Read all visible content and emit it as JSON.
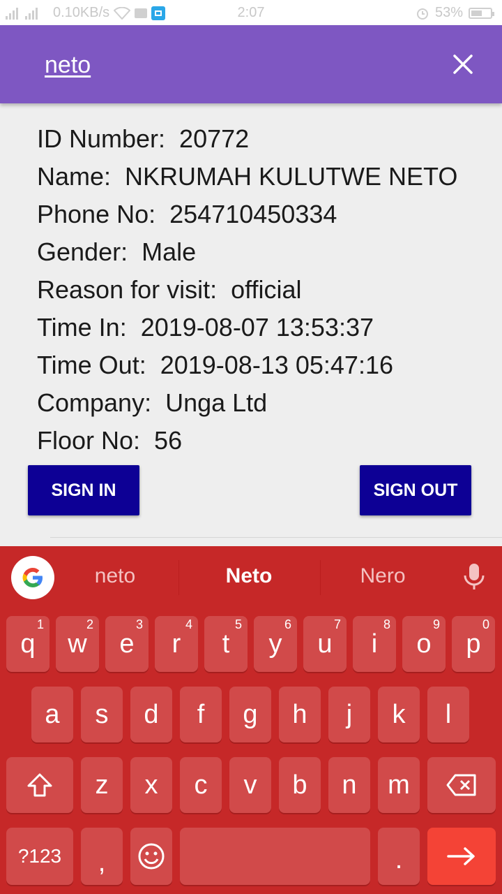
{
  "status_bar": {
    "network_speed": "0.10KB/s",
    "time": "2:07",
    "battery": "53%",
    "battery_level": 0.53
  },
  "app_bar": {
    "search_query": "neto",
    "close_icon": "close-icon"
  },
  "visitor": {
    "fields": [
      {
        "label": "ID Number:",
        "value": "20772"
      },
      {
        "label": "Name:",
        "value": "NKRUMAH KULUTWE NETO"
      },
      {
        "label": "Phone No:",
        "value": "254710450334"
      },
      {
        "label": "Gender:",
        "value": "Male"
      },
      {
        "label": "Reason for visit:",
        "value": "official"
      },
      {
        "label": "Time In:",
        "value": "2019-08-07 13:53:37"
      },
      {
        "label": "Time Out:",
        "value": "2019-08-13 05:47:16"
      },
      {
        "label": "Company:",
        "value": "Unga Ltd"
      },
      {
        "label": "Floor No:",
        "value": "56"
      }
    ]
  },
  "actions": {
    "sign_in": "SIGN IN",
    "sign_out": "SIGN OUT"
  },
  "keyboard": {
    "suggestions": [
      "neto",
      "Neto",
      "Nero"
    ],
    "row1": [
      [
        "q",
        "1"
      ],
      [
        "w",
        "2"
      ],
      [
        "e",
        "3"
      ],
      [
        "r",
        "4"
      ],
      [
        "t",
        "5"
      ],
      [
        "y",
        "6"
      ],
      [
        "u",
        "7"
      ],
      [
        "i",
        "8"
      ],
      [
        "o",
        "9"
      ],
      [
        "p",
        "0"
      ]
    ],
    "row2": [
      "a",
      "s",
      "d",
      "f",
      "g",
      "h",
      "j",
      "k",
      "l"
    ],
    "row3": [
      "z",
      "x",
      "c",
      "v",
      "b",
      "n",
      "m"
    ],
    "symbols_key": "?123",
    "comma_key": ",",
    "period_key": ".",
    "colors": {
      "background": "#c62828",
      "key": "#d14a4a",
      "enter": "#f44336"
    }
  },
  "colors": {
    "app_bar": "#7e57c2",
    "button": "#0d0095"
  }
}
